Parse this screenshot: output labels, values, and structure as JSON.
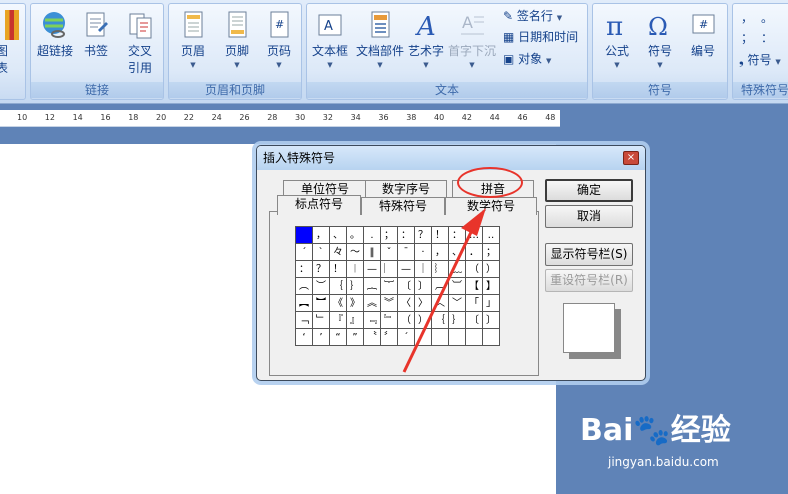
{
  "ribbon": {
    "partial_left_label": "图表",
    "groups": [
      {
        "title": "链接",
        "buttons": [
          {
            "label": "超链接"
          },
          {
            "label": "书签"
          },
          {
            "label": "交叉\n引用"
          }
        ]
      },
      {
        "title": "页眉和页脚",
        "buttons": [
          {
            "label": "页眉"
          },
          {
            "label": "页脚"
          },
          {
            "label": "页码"
          }
        ]
      },
      {
        "title": "文本",
        "buttons": [
          {
            "label": "文本框"
          },
          {
            "label": "文档部件"
          },
          {
            "label": "艺术字"
          },
          {
            "label": "首字下沉"
          }
        ],
        "small": [
          {
            "label": "签名行"
          },
          {
            "label": "日期和时间"
          },
          {
            "label": "对象"
          }
        ]
      },
      {
        "title": "符号",
        "buttons": [
          {
            "label": "公式"
          },
          {
            "label": "符号"
          },
          {
            "label": "编号"
          }
        ]
      },
      {
        "title": "特殊符号",
        "small": [
          {
            "label": "符号"
          }
        ]
      }
    ]
  },
  "ruler": {
    "ticks": [
      "10",
      "12",
      "14",
      "16",
      "18",
      "20",
      "22",
      "24",
      "26",
      "28",
      "30",
      "32",
      "34",
      "36",
      "38",
      "40",
      "42",
      "44",
      "46",
      "48"
    ]
  },
  "dialog": {
    "title": "插入特殊符号",
    "close_glyph": "×",
    "tabs_back": [
      "单位符号",
      "数字序号",
      "拼音"
    ],
    "tabs_front": [
      "标点符号",
      "特殊符号",
      "数学符号"
    ],
    "grid": [
      [
        "",
        "，",
        "、",
        "。",
        ".",
        "；",
        "：",
        "？",
        "！",
        "：",
        "…",
        "‥"
      ],
      [
        "ˊ",
        "ˋ",
        "々",
        "～",
        "‖",
        "ˇ",
        "ˉ",
        "·",
        "，",
        "、",
        "．",
        "；"
      ],
      [
        "：",
        "？",
        "！",
        "︱",
        "—",
        "︳",
        "—",
        "｜",
        "︴",
        "﹏",
        "（",
        "）"
      ],
      [
        "︵",
        "︶",
        "｛",
        "｝",
        "︷",
        "︸",
        "〔",
        "〕",
        "︹",
        "︺",
        "【",
        "】"
      ],
      [
        "︻",
        "︼",
        "《",
        "》",
        "︽",
        "︾",
        "〈",
        "〉",
        "︿",
        "﹀",
        "「",
        "」"
      ],
      [
        "﹁",
        "﹂",
        "『",
        "』",
        "﹃",
        "﹄",
        "（",
        "）",
        "｛",
        "｝",
        "〔",
        "〕"
      ],
      [
        "‘",
        "’",
        "“",
        "”",
        "〝",
        "〞",
        "ˊ",
        "ˋ",
        "",
        "",
        "",
        ""
      ]
    ],
    "buttons": {
      "ok": "确定",
      "cancel": "取消",
      "show_bar": "显示符号栏(S)",
      "reset_bar": "重设符号栏(R)"
    }
  },
  "watermark": {
    "brand": "Bai🐾经验",
    "url": "jingyan.baidu.com"
  },
  "colors": {
    "annotation": "#e8342b",
    "selected_cell": "#0000ff"
  }
}
